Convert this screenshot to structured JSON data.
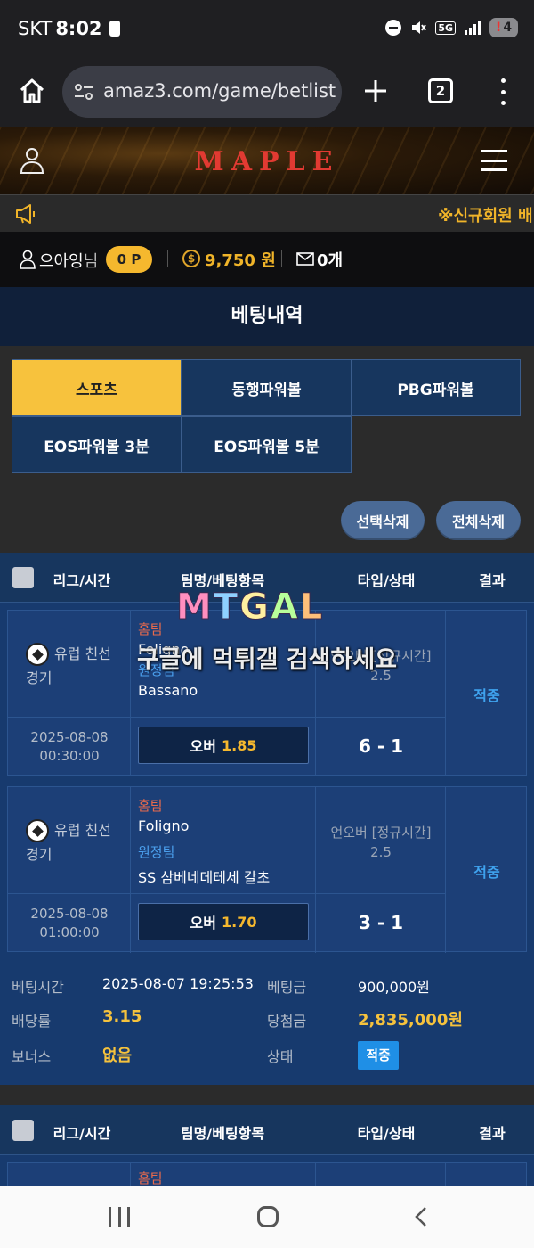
{
  "status_bar": {
    "carrier": "SKT",
    "time": "8:02",
    "network": "5G",
    "battery": "4"
  },
  "browser": {
    "url": "amaz3.com/game/betlist",
    "tab_count": "2"
  },
  "site": {
    "logo": "MAPLE",
    "notice": "※신규회원 배"
  },
  "user": {
    "name": "으아잉",
    "honorific": "님",
    "points": "0 P",
    "coin_symbol": "$",
    "money": "9,750 원",
    "messages": "0개"
  },
  "page_title": "베팅내역",
  "tabs": [
    {
      "label": "스포츠",
      "active": true
    },
    {
      "label": "동행파워볼",
      "active": false
    },
    {
      "label": "PBG파워볼",
      "active": false
    },
    {
      "label": "EOS파워볼 3분",
      "active": false
    },
    {
      "label": "EOS파워볼 5분",
      "active": false
    }
  ],
  "actions": {
    "delete_selected": "선택삭제",
    "delete_all": "전체삭제"
  },
  "table_headers": {
    "league_time": "리그/시간",
    "team_bet": "팀명/베팅항목",
    "type_status": "타입/상태",
    "result": "결과"
  },
  "bet_slip_1": {
    "matches": [
      {
        "league": "유럽 친선",
        "league2": "경기",
        "home_label": "홈팀",
        "home_team": "Foligno",
        "away_label": "원정팀",
        "away_team": "Bassano",
        "type": "언오버 [정규시간]",
        "line": "2.5",
        "date": "2025-08-08",
        "time": "00:30:00",
        "pick": "오버",
        "odds": "1.85",
        "score": "6 - 1",
        "result": "적중"
      },
      {
        "league": "유럽 친선",
        "league2": "경기",
        "home_label": "홈팀",
        "home_team": "Foligno",
        "away_label": "원정팀",
        "away_team": "SS 삼베네데테세 칼초",
        "type": "언오버 [정규시간]",
        "line": "2.5",
        "date": "2025-08-08",
        "time": "01:00:00",
        "pick": "오버",
        "odds": "1.70",
        "score": "3 - 1",
        "result": "적중"
      }
    ],
    "summary": {
      "bet_time_label": "베팅시간",
      "bet_time": "2025-08-07 19:25:53",
      "bet_amount_label": "베팅금",
      "bet_amount": "900,000원",
      "odds_label": "배당률",
      "odds": "3.15",
      "win_amount_label": "당첨금",
      "win_amount": "2,835,000원",
      "bonus_label": "보너스",
      "bonus": "없음",
      "status_label": "상태",
      "status": "적중"
    }
  },
  "bet_slip_2": {
    "home_label": "홈팀"
  },
  "watermark": {
    "logo": "MTGAL",
    "text": "구글에 먹튀갤 검색하세요"
  },
  "colors": {
    "accent": "#f7c23d",
    "panel": "#173a6e",
    "hit": "#1f8fe6",
    "home": "#e86a4c",
    "away": "#4ba0ee"
  }
}
